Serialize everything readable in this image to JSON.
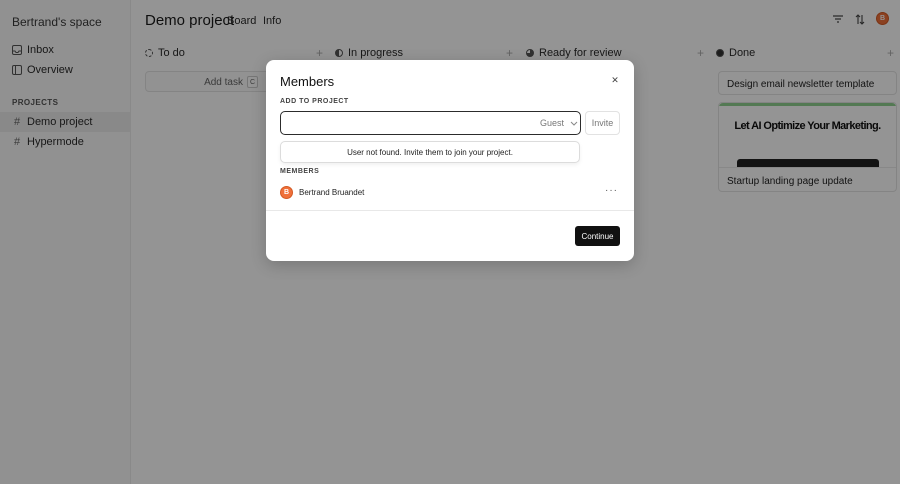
{
  "sidebar": {
    "space_name": "Bertrand's space",
    "items": [
      {
        "label": "Inbox",
        "icon": "inbox-icon"
      },
      {
        "label": "Overview",
        "icon": "overview-icon"
      }
    ],
    "projects_label": "PROJECTS",
    "projects": [
      {
        "label": "Demo project",
        "active": true
      },
      {
        "label": "Hypermode",
        "active": false
      }
    ]
  },
  "header": {
    "title": "Demo project",
    "tabs": [
      {
        "label": "Board"
      },
      {
        "label": "Info"
      }
    ],
    "icons": [
      "filter-icon",
      "sort-icon",
      "user-avatar"
    ]
  },
  "board": {
    "columns": [
      {
        "label": "To do",
        "status": "todo"
      },
      {
        "label": "In progress",
        "status": "in-progress"
      },
      {
        "label": "Ready for review",
        "status": "review"
      },
      {
        "label": "Done",
        "status": "done"
      }
    ],
    "add_task_label": "Add task",
    "add_task_shortcut": "C",
    "cards": [
      {
        "title": "Design email newsletter template"
      },
      {
        "title": "Startup landing page update",
        "thumbnail_headline": "Let AI Optimize Your Marketing."
      }
    ]
  },
  "modal": {
    "title": "Members",
    "add_section_label": "ADD TO PROJECT",
    "email_value": "",
    "role_value": "Guest",
    "invite_label": "Invite",
    "notice": "User not found. Invite them to join your project.",
    "members_section_label": "MEMBERS",
    "members": [
      {
        "name": "Bertrand Bruandet"
      }
    ],
    "continue_label": "Continue"
  },
  "colors": {
    "avatar": "#f0703a",
    "primary_button": "#111111",
    "overlay": "rgba(0,0,0,0.42)"
  }
}
